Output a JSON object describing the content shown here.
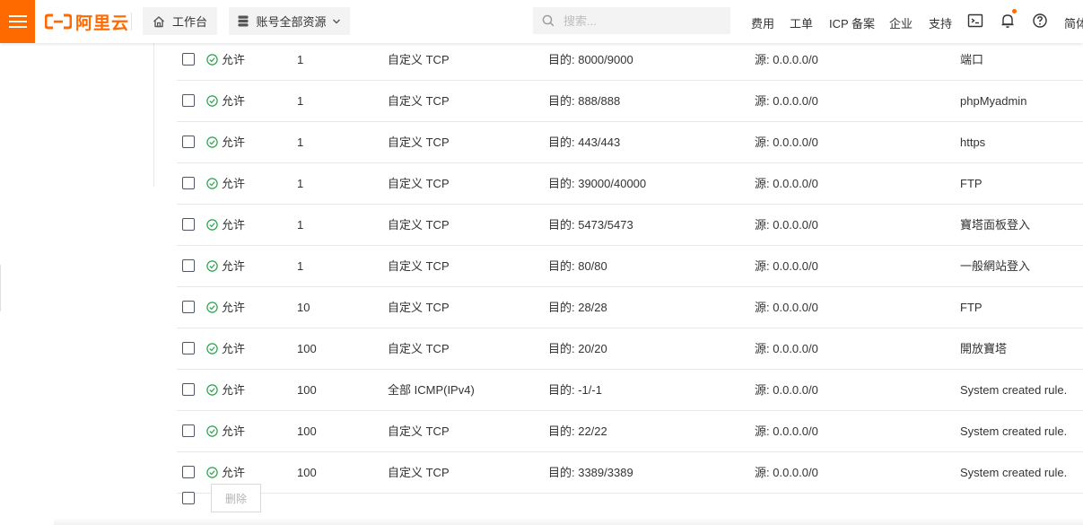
{
  "topbar": {
    "logo_text": "阿里云",
    "workbench_label": "工作台",
    "resource_select_label": "账号全部资源",
    "search_placeholder": "搜索...",
    "nav": {
      "billing": "费用",
      "ticket": "工单",
      "icp": "ICP 备案",
      "enterprise": "企业",
      "support": "支持",
      "language": "简体"
    },
    "accent_color": "#ff6a00"
  },
  "rules": [
    {
      "policy": "允许",
      "priority": "1",
      "protocol": "自定义 TCP",
      "dest": "目的: 8000/9000",
      "source": "源: 0.0.0.0/0",
      "description": "端口"
    },
    {
      "policy": "允许",
      "priority": "1",
      "protocol": "自定义 TCP",
      "dest": "目的: 888/888",
      "source": "源: 0.0.0.0/0",
      "description": "phpMyadmin"
    },
    {
      "policy": "允许",
      "priority": "1",
      "protocol": "自定义 TCP",
      "dest": "目的: 443/443",
      "source": "源: 0.0.0.0/0",
      "description": "https"
    },
    {
      "policy": "允许",
      "priority": "1",
      "protocol": "自定义 TCP",
      "dest": "目的: 39000/40000",
      "source": "源: 0.0.0.0/0",
      "description": "FTP"
    },
    {
      "policy": "允许",
      "priority": "1",
      "protocol": "自定义 TCP",
      "dest": "目的: 5473/5473",
      "source": "源: 0.0.0.0/0",
      "description": "寶塔面板登入"
    },
    {
      "policy": "允许",
      "priority": "1",
      "protocol": "自定义 TCP",
      "dest": "目的: 80/80",
      "source": "源: 0.0.0.0/0",
      "description": "一般網站登入"
    },
    {
      "policy": "允许",
      "priority": "10",
      "protocol": "自定义 TCP",
      "dest": "目的: 28/28",
      "source": "源: 0.0.0.0/0",
      "description": "FTP"
    },
    {
      "policy": "允许",
      "priority": "100",
      "protocol": "自定义 TCP",
      "dest": "目的: 20/20",
      "source": "源: 0.0.0.0/0",
      "description": "開放寶塔"
    },
    {
      "policy": "允许",
      "priority": "100",
      "protocol": "全部 ICMP(IPv4)",
      "dest": "目的: -1/-1",
      "source": "源: 0.0.0.0/0",
      "description": "System created rule."
    },
    {
      "policy": "允许",
      "priority": "100",
      "protocol": "自定义 TCP",
      "dest": "目的: 22/22",
      "source": "源: 0.0.0.0/0",
      "description": "System created rule."
    },
    {
      "policy": "允许",
      "priority": "100",
      "protocol": "自定义 TCP",
      "dest": "目的: 3389/3389",
      "source": "源: 0.0.0.0/0",
      "description": "System created rule."
    }
  ],
  "footer": {
    "delete_label": "删除"
  },
  "icons": {
    "allow_color": "#1ea848"
  }
}
